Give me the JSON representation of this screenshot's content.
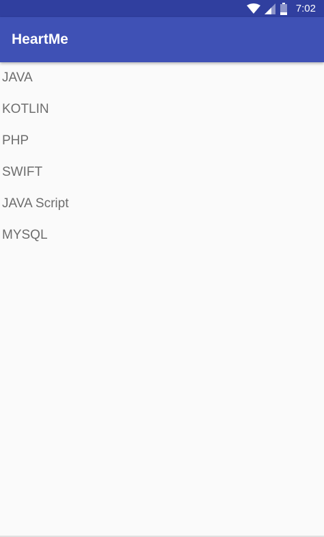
{
  "status_bar": {
    "time": "7:02",
    "icons": [
      "wifi-icon",
      "signal-icon",
      "battery-icon"
    ],
    "color": "#303f9f"
  },
  "app_bar": {
    "title": "HeartMe",
    "color": "#3f51b5"
  },
  "list": {
    "items": [
      {
        "label": "JAVA"
      },
      {
        "label": "KOTLIN"
      },
      {
        "label": "PHP"
      },
      {
        "label": "SWIFT"
      },
      {
        "label": "JAVA Script"
      },
      {
        "label": "MYSQL"
      }
    ]
  }
}
